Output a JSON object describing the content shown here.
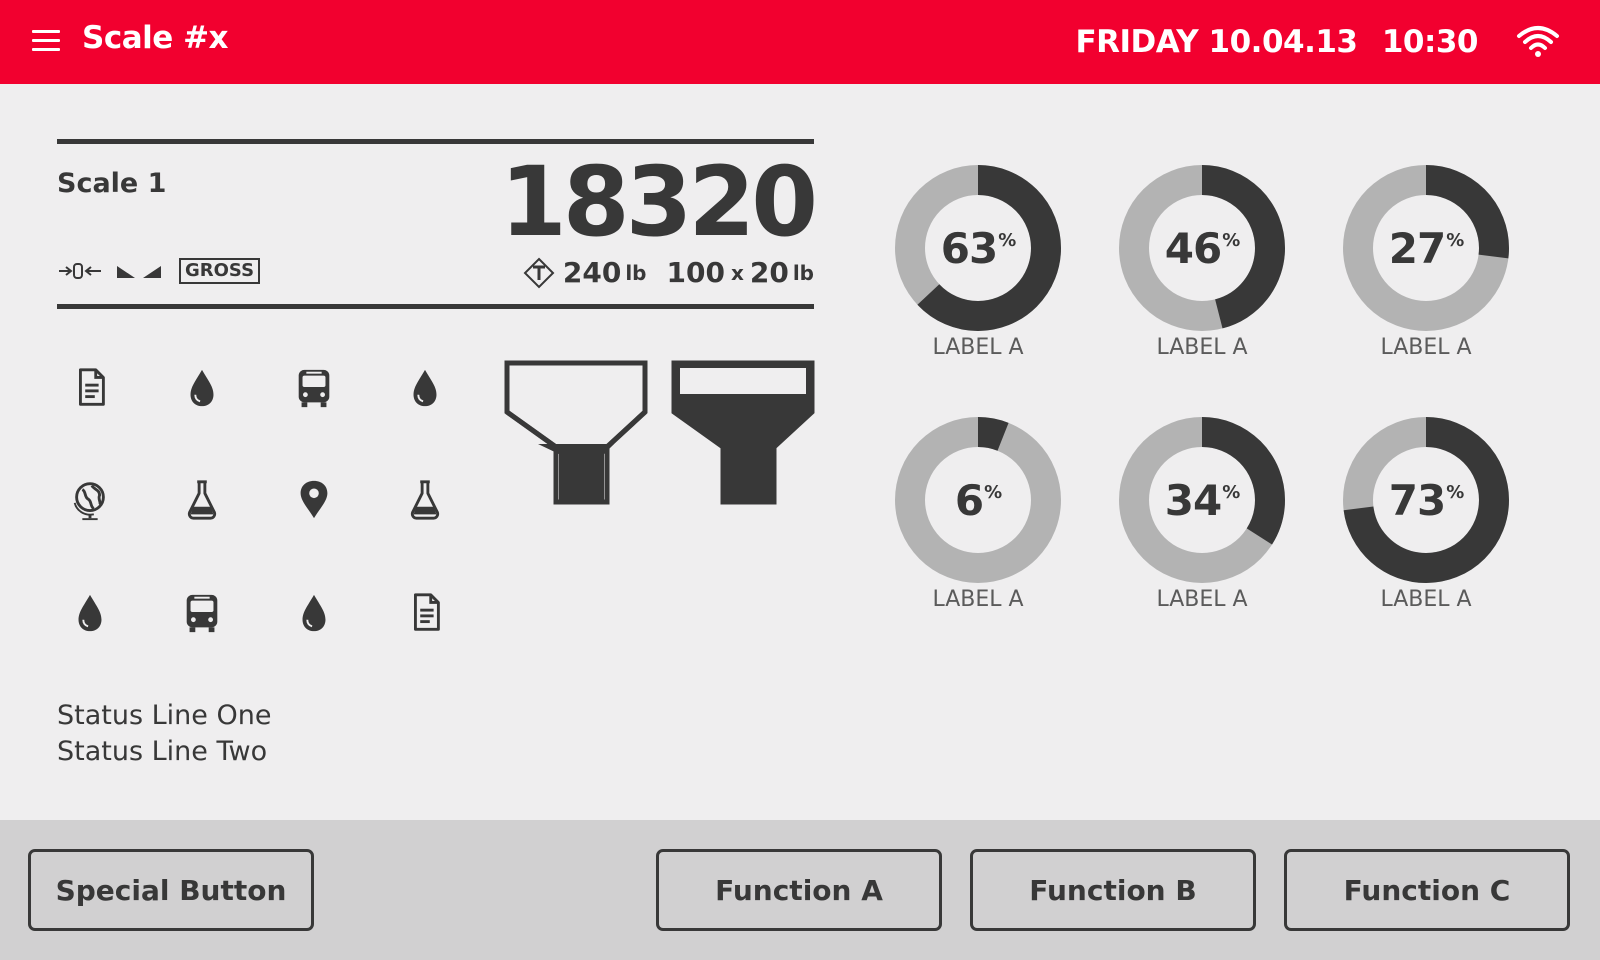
{
  "header": {
    "title": "Scale #x",
    "day": "FRIDAY",
    "date": "10.04.13",
    "time": "10:30",
    "menu_icon": "hamburger-menu-icon",
    "wifi_icon": "wifi-icon",
    "background_color": "#f2002f"
  },
  "scale": {
    "name": "Scale 1",
    "weight": "18320",
    "mode_badge": "GROSS",
    "tare_value": "240",
    "tare_unit": "lb",
    "capacity": "100",
    "capacity_sep": "x",
    "division": "20",
    "division_unit": "lb",
    "indicator_icons": [
      "center-of-zero-icon",
      "stable-icon",
      "tare-icon"
    ]
  },
  "icons": [
    "document-icon",
    "drop-icon",
    "bus-icon",
    "drop-icon",
    "globe-icon",
    "flask-icon",
    "location-pin-icon",
    "flask-icon",
    "drop-icon",
    "bus-icon",
    "drop-icon",
    "document-icon"
  ],
  "hoppers": [
    {
      "name": "hopper-1",
      "fill_level": 0.3
    },
    {
      "name": "hopper-2",
      "fill_level": 0.8
    }
  ],
  "status": {
    "line1": "Status Line One",
    "line2": "Status Line Two"
  },
  "gauges": [
    {
      "value": 63,
      "display": "63",
      "unit": "%",
      "label": "LABEL A"
    },
    {
      "value": 46,
      "display": "46",
      "unit": "%",
      "label": "LABEL A"
    },
    {
      "value": 27,
      "display": "27",
      "unit": "%",
      "label": "LABEL A"
    },
    {
      "value": 6,
      "display": "6",
      "unit": "%",
      "label": "LABEL A"
    },
    {
      "value": 34,
      "display": "34",
      "unit": "%",
      "label": "LABEL A"
    },
    {
      "value": 73,
      "display": "73",
      "unit": "%",
      "label": "LABEL A"
    }
  ],
  "footer": {
    "special": "Special Button",
    "function_a": "Function A",
    "function_b": "Function B",
    "function_c": "Function C"
  },
  "colors": {
    "accent": "#f2002f",
    "dark": "#383838",
    "gauge_track": "#b3b3b3",
    "background": "#efeeef",
    "footer": "#d1d0d1"
  }
}
